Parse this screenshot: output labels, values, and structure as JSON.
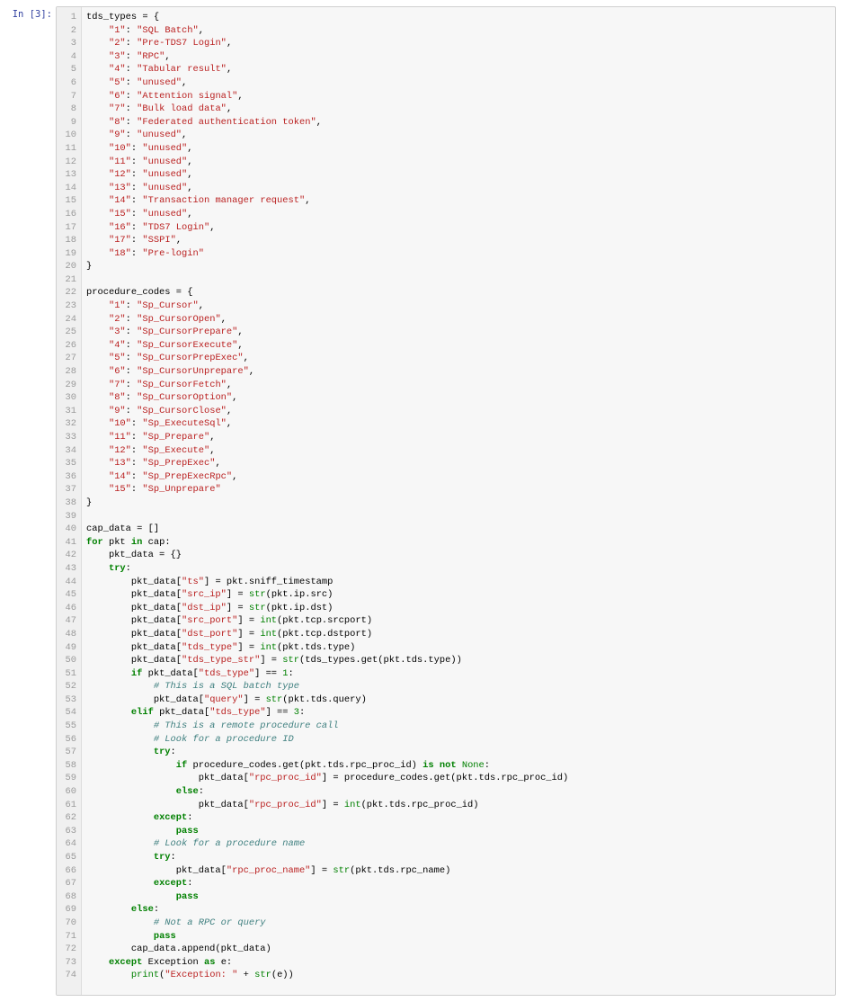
{
  "cell": {
    "prompt": "In [3]:",
    "lines": [
      [
        [
          "tds_types = {",
          ""
        ]
      ],
      [
        [
          "    ",
          ""
        ],
        [
          "\"1\"",
          "st"
        ],
        [
          ": ",
          ""
        ],
        [
          "\"SQL Batch\"",
          "st"
        ],
        [
          ",",
          ""
        ]
      ],
      [
        [
          "    ",
          ""
        ],
        [
          "\"2\"",
          "st"
        ],
        [
          ": ",
          ""
        ],
        [
          "\"Pre-TDS7 Login\"",
          "st"
        ],
        [
          ",",
          ""
        ]
      ],
      [
        [
          "    ",
          ""
        ],
        [
          "\"3\"",
          "st"
        ],
        [
          ": ",
          ""
        ],
        [
          "\"RPC\"",
          "st"
        ],
        [
          ",",
          ""
        ]
      ],
      [
        [
          "    ",
          ""
        ],
        [
          "\"4\"",
          "st"
        ],
        [
          ": ",
          ""
        ],
        [
          "\"Tabular result\"",
          "st"
        ],
        [
          ",",
          ""
        ]
      ],
      [
        [
          "    ",
          ""
        ],
        [
          "\"5\"",
          "st"
        ],
        [
          ": ",
          ""
        ],
        [
          "\"unused\"",
          "st"
        ],
        [
          ",",
          ""
        ]
      ],
      [
        [
          "    ",
          ""
        ],
        [
          "\"6\"",
          "st"
        ],
        [
          ": ",
          ""
        ],
        [
          "\"Attention signal\"",
          "st"
        ],
        [
          ",",
          ""
        ]
      ],
      [
        [
          "    ",
          ""
        ],
        [
          "\"7\"",
          "st"
        ],
        [
          ": ",
          ""
        ],
        [
          "\"Bulk load data\"",
          "st"
        ],
        [
          ",",
          ""
        ]
      ],
      [
        [
          "    ",
          ""
        ],
        [
          "\"8\"",
          "st"
        ],
        [
          ": ",
          ""
        ],
        [
          "\"Federated authentication token\"",
          "st"
        ],
        [
          ",",
          ""
        ]
      ],
      [
        [
          "    ",
          ""
        ],
        [
          "\"9\"",
          "st"
        ],
        [
          ": ",
          ""
        ],
        [
          "\"unused\"",
          "st"
        ],
        [
          ",",
          ""
        ]
      ],
      [
        [
          "    ",
          ""
        ],
        [
          "\"10\"",
          "st"
        ],
        [
          ": ",
          ""
        ],
        [
          "\"unused\"",
          "st"
        ],
        [
          ",",
          ""
        ]
      ],
      [
        [
          "    ",
          ""
        ],
        [
          "\"11\"",
          "st"
        ],
        [
          ": ",
          ""
        ],
        [
          "\"unused\"",
          "st"
        ],
        [
          ",",
          ""
        ]
      ],
      [
        [
          "    ",
          ""
        ],
        [
          "\"12\"",
          "st"
        ],
        [
          ": ",
          ""
        ],
        [
          "\"unused\"",
          "st"
        ],
        [
          ",",
          ""
        ]
      ],
      [
        [
          "    ",
          ""
        ],
        [
          "\"13\"",
          "st"
        ],
        [
          ": ",
          ""
        ],
        [
          "\"unused\"",
          "st"
        ],
        [
          ",",
          ""
        ]
      ],
      [
        [
          "    ",
          ""
        ],
        [
          "\"14\"",
          "st"
        ],
        [
          ": ",
          ""
        ],
        [
          "\"Transaction manager request\"",
          "st"
        ],
        [
          ",",
          ""
        ]
      ],
      [
        [
          "    ",
          ""
        ],
        [
          "\"15\"",
          "st"
        ],
        [
          ": ",
          ""
        ],
        [
          "\"unused\"",
          "st"
        ],
        [
          ",",
          ""
        ]
      ],
      [
        [
          "    ",
          ""
        ],
        [
          "\"16\"",
          "st"
        ],
        [
          ": ",
          ""
        ],
        [
          "\"TDS7 Login\"",
          "st"
        ],
        [
          ",",
          ""
        ]
      ],
      [
        [
          "    ",
          ""
        ],
        [
          "\"17\"",
          "st"
        ],
        [
          ": ",
          ""
        ],
        [
          "\"SSPI\"",
          "st"
        ],
        [
          ",",
          ""
        ]
      ],
      [
        [
          "    ",
          ""
        ],
        [
          "\"18\"",
          "st"
        ],
        [
          ": ",
          ""
        ],
        [
          "\"Pre-login\"",
          "st"
        ]
      ],
      [
        [
          "}",
          ""
        ]
      ],
      [],
      [
        [
          "procedure_codes = {",
          ""
        ]
      ],
      [
        [
          "    ",
          ""
        ],
        [
          "\"1\"",
          "st"
        ],
        [
          ": ",
          ""
        ],
        [
          "\"Sp_Cursor\"",
          "st"
        ],
        [
          ",",
          ""
        ]
      ],
      [
        [
          "    ",
          ""
        ],
        [
          "\"2\"",
          "st"
        ],
        [
          ": ",
          ""
        ],
        [
          "\"Sp_CursorOpen\"",
          "st"
        ],
        [
          ",",
          ""
        ]
      ],
      [
        [
          "    ",
          ""
        ],
        [
          "\"3\"",
          "st"
        ],
        [
          ": ",
          ""
        ],
        [
          "\"Sp_CursorPrepare\"",
          "st"
        ],
        [
          ",",
          ""
        ]
      ],
      [
        [
          "    ",
          ""
        ],
        [
          "\"4\"",
          "st"
        ],
        [
          ": ",
          ""
        ],
        [
          "\"Sp_CursorExecute\"",
          "st"
        ],
        [
          ",",
          ""
        ]
      ],
      [
        [
          "    ",
          ""
        ],
        [
          "\"5\"",
          "st"
        ],
        [
          ": ",
          ""
        ],
        [
          "\"Sp_CursorPrepExec\"",
          "st"
        ],
        [
          ",",
          ""
        ]
      ],
      [
        [
          "    ",
          ""
        ],
        [
          "\"6\"",
          "st"
        ],
        [
          ": ",
          ""
        ],
        [
          "\"Sp_CursorUnprepare\"",
          "st"
        ],
        [
          ",",
          ""
        ]
      ],
      [
        [
          "    ",
          ""
        ],
        [
          "\"7\"",
          "st"
        ],
        [
          ": ",
          ""
        ],
        [
          "\"Sp_CursorFetch\"",
          "st"
        ],
        [
          ",",
          ""
        ]
      ],
      [
        [
          "    ",
          ""
        ],
        [
          "\"8\"",
          "st"
        ],
        [
          ": ",
          ""
        ],
        [
          "\"Sp_CursorOption\"",
          "st"
        ],
        [
          ",",
          ""
        ]
      ],
      [
        [
          "    ",
          ""
        ],
        [
          "\"9\"",
          "st"
        ],
        [
          ": ",
          ""
        ],
        [
          "\"Sp_CursorClose\"",
          "st"
        ],
        [
          ",",
          ""
        ]
      ],
      [
        [
          "    ",
          ""
        ],
        [
          "\"10\"",
          "st"
        ],
        [
          ": ",
          ""
        ],
        [
          "\"Sp_ExecuteSql\"",
          "st"
        ],
        [
          ",",
          ""
        ]
      ],
      [
        [
          "    ",
          ""
        ],
        [
          "\"11\"",
          "st"
        ],
        [
          ": ",
          ""
        ],
        [
          "\"Sp_Prepare\"",
          "st"
        ],
        [
          ",",
          ""
        ]
      ],
      [
        [
          "    ",
          ""
        ],
        [
          "\"12\"",
          "st"
        ],
        [
          ": ",
          ""
        ],
        [
          "\"Sp_Execute\"",
          "st"
        ],
        [
          ",",
          ""
        ]
      ],
      [
        [
          "    ",
          ""
        ],
        [
          "\"13\"",
          "st"
        ],
        [
          ": ",
          ""
        ],
        [
          "\"Sp_PrepExec\"",
          "st"
        ],
        [
          ",",
          ""
        ]
      ],
      [
        [
          "    ",
          ""
        ],
        [
          "\"14\"",
          "st"
        ],
        [
          ": ",
          ""
        ],
        [
          "\"Sp_PrepExecRpc\"",
          "st"
        ],
        [
          ",",
          ""
        ]
      ],
      [
        [
          "    ",
          ""
        ],
        [
          "\"15\"",
          "st"
        ],
        [
          ": ",
          ""
        ],
        [
          "\"Sp_Unprepare\"",
          "st"
        ]
      ],
      [
        [
          "}",
          ""
        ]
      ],
      [],
      [
        [
          "cap_data = []",
          ""
        ]
      ],
      [
        [
          "for",
          "kw"
        ],
        [
          " pkt ",
          ""
        ],
        [
          "in",
          "kw"
        ],
        [
          " cap:",
          ""
        ]
      ],
      [
        [
          "    pkt_data = {}",
          ""
        ]
      ],
      [
        [
          "    ",
          ""
        ],
        [
          "try",
          "kw"
        ],
        [
          ":",
          ""
        ]
      ],
      [
        [
          "        pkt_data[",
          ""
        ],
        [
          "\"ts\"",
          "st"
        ],
        [
          "] = pkt.sniff_timestamp",
          ""
        ]
      ],
      [
        [
          "        pkt_data[",
          ""
        ],
        [
          "\"src_ip\"",
          "st"
        ],
        [
          "] = ",
          ""
        ],
        [
          "str",
          "bi"
        ],
        [
          "(pkt.ip.src)",
          ""
        ]
      ],
      [
        [
          "        pkt_data[",
          ""
        ],
        [
          "\"dst_ip\"",
          "st"
        ],
        [
          "] = ",
          ""
        ],
        [
          "str",
          "bi"
        ],
        [
          "(pkt.ip.dst)",
          ""
        ]
      ],
      [
        [
          "        pkt_data[",
          ""
        ],
        [
          "\"src_port\"",
          "st"
        ],
        [
          "] = ",
          ""
        ],
        [
          "int",
          "bi"
        ],
        [
          "(pkt.tcp.srcport)",
          ""
        ]
      ],
      [
        [
          "        pkt_data[",
          ""
        ],
        [
          "\"dst_port\"",
          "st"
        ],
        [
          "] = ",
          ""
        ],
        [
          "int",
          "bi"
        ],
        [
          "(pkt.tcp.dstport)",
          ""
        ]
      ],
      [
        [
          "        pkt_data[",
          ""
        ],
        [
          "\"tds_type\"",
          "st"
        ],
        [
          "] = ",
          ""
        ],
        [
          "int",
          "bi"
        ],
        [
          "(pkt.tds.type)",
          ""
        ]
      ],
      [
        [
          "        pkt_data[",
          ""
        ],
        [
          "\"tds_type_str\"",
          "st"
        ],
        [
          "] = ",
          ""
        ],
        [
          "str",
          "bi"
        ],
        [
          "(tds_types.get(pkt.tds.type))",
          ""
        ]
      ],
      [
        [
          "        ",
          ""
        ],
        [
          "if",
          "kw"
        ],
        [
          " pkt_data[",
          ""
        ],
        [
          "\"tds_type\"",
          "st"
        ],
        [
          "] == ",
          ""
        ],
        [
          "1",
          "nm"
        ],
        [
          ":",
          ""
        ]
      ],
      [
        [
          "            ",
          ""
        ],
        [
          "# This is a SQL batch type",
          "cm"
        ]
      ],
      [
        [
          "            pkt_data[",
          ""
        ],
        [
          "\"query\"",
          "st"
        ],
        [
          "] = ",
          ""
        ],
        [
          "str",
          "bi"
        ],
        [
          "(pkt.tds.query)",
          ""
        ]
      ],
      [
        [
          "        ",
          ""
        ],
        [
          "elif",
          "kw"
        ],
        [
          " pkt_data[",
          ""
        ],
        [
          "\"tds_type\"",
          "st"
        ],
        [
          "] == ",
          ""
        ],
        [
          "3",
          "nm"
        ],
        [
          ":",
          ""
        ]
      ],
      [
        [
          "            ",
          ""
        ],
        [
          "# This is a remote procedure call",
          "cm"
        ]
      ],
      [
        [
          "            ",
          ""
        ],
        [
          "# Look for a procedure ID",
          "cm"
        ]
      ],
      [
        [
          "            ",
          ""
        ],
        [
          "try",
          "kw"
        ],
        [
          ":",
          ""
        ]
      ],
      [
        [
          "                ",
          ""
        ],
        [
          "if",
          "kw"
        ],
        [
          " procedure_codes.get(pkt.tds.rpc_proc_id) ",
          ""
        ],
        [
          "is not",
          "kw"
        ],
        [
          " ",
          ""
        ],
        [
          "None",
          "bi"
        ],
        [
          ":",
          ""
        ]
      ],
      [
        [
          "                    pkt_data[",
          ""
        ],
        [
          "\"rpc_proc_id\"",
          "st"
        ],
        [
          "] = procedure_codes.get(pkt.tds.rpc_proc_id)",
          ""
        ]
      ],
      [
        [
          "                ",
          ""
        ],
        [
          "else",
          "kw"
        ],
        [
          ":",
          ""
        ]
      ],
      [
        [
          "                    pkt_data[",
          ""
        ],
        [
          "\"rpc_proc_id\"",
          "st"
        ],
        [
          "] = ",
          ""
        ],
        [
          "int",
          "bi"
        ],
        [
          "(pkt.tds.rpc_proc_id)",
          ""
        ]
      ],
      [
        [
          "            ",
          ""
        ],
        [
          "except",
          "kw"
        ],
        [
          ":",
          ""
        ]
      ],
      [
        [
          "                ",
          ""
        ],
        [
          "pass",
          "kw"
        ]
      ],
      [
        [
          "            ",
          ""
        ],
        [
          "# Look for a procedure name",
          "cm"
        ]
      ],
      [
        [
          "            ",
          ""
        ],
        [
          "try",
          "kw"
        ],
        [
          ":",
          ""
        ]
      ],
      [
        [
          "                pkt_data[",
          ""
        ],
        [
          "\"rpc_proc_name\"",
          "st"
        ],
        [
          "] = ",
          ""
        ],
        [
          "str",
          "bi"
        ],
        [
          "(pkt.tds.rpc_name)",
          ""
        ]
      ],
      [
        [
          "            ",
          ""
        ],
        [
          "except",
          "kw"
        ],
        [
          ":",
          ""
        ]
      ],
      [
        [
          "                ",
          ""
        ],
        [
          "pass",
          "kw"
        ]
      ],
      [
        [
          "        ",
          ""
        ],
        [
          "else",
          "kw"
        ],
        [
          ":",
          ""
        ]
      ],
      [
        [
          "            ",
          ""
        ],
        [
          "# Not a RPC or query",
          "cm"
        ]
      ],
      [
        [
          "            ",
          ""
        ],
        [
          "pass",
          "kw"
        ]
      ],
      [
        [
          "        cap_data.append(pkt_data)",
          ""
        ]
      ],
      [
        [
          "    ",
          ""
        ],
        [
          "except",
          "kw"
        ],
        [
          " Exception ",
          ""
        ],
        [
          "as",
          "kw"
        ],
        [
          " e:",
          ""
        ]
      ],
      [
        [
          "        ",
          ""
        ],
        [
          "print",
          "bi"
        ],
        [
          "(",
          ""
        ],
        [
          "\"Exception: \"",
          "st"
        ],
        [
          " + ",
          ""
        ],
        [
          "str",
          "bi"
        ],
        [
          "(e))",
          ""
        ]
      ]
    ]
  }
}
